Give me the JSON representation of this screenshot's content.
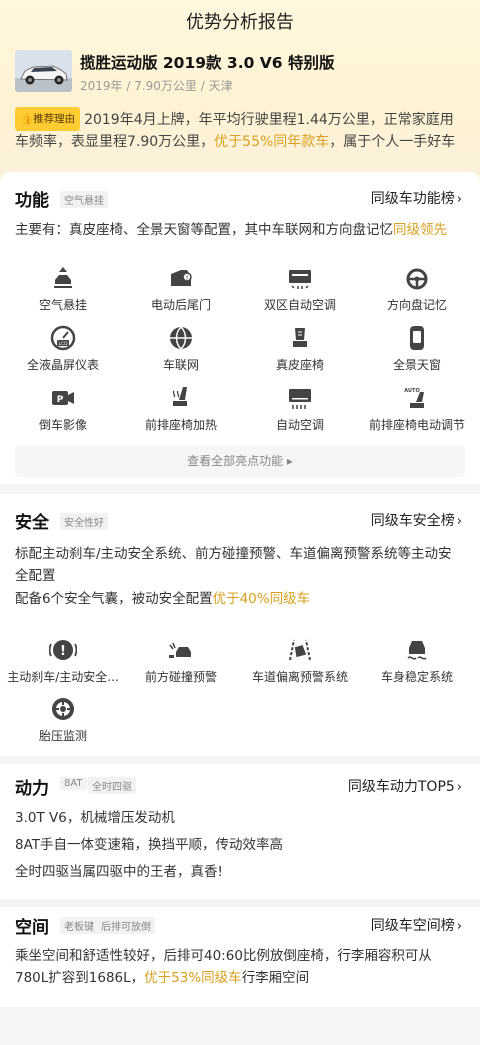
{
  "header": {
    "title": "优势分析报告"
  },
  "car": {
    "name": "揽胜运动版 2019款 3.0 V6 特别版",
    "meta": "2019年 / 7.90万公里 / 天津"
  },
  "reason": {
    "badge": "推荐理由",
    "text_before": "2019年4月上牌，年平均行驶里程1.44万公里，正常家庭用车频率，表显里程7.90万公里，",
    "highlight": "优于55%同年款车",
    "text_after": "，属于个人一手好车"
  },
  "function": {
    "title": "功能",
    "tag": "空气悬挂",
    "link": "同级车功能榜",
    "summary_before": "主要有：真皮座椅、全景天窗等配置，其中车联网和方向盘记忆",
    "summary_hl": "同级领先",
    "features": [
      {
        "label": "空气悬挂",
        "icon": "air-suspension-icon"
      },
      {
        "label": "电动后尾门",
        "icon": "power-tailgate-icon"
      },
      {
        "label": "双区自动空调",
        "icon": "dual-zone-ac-icon"
      },
      {
        "label": "方向盘记忆",
        "icon": "steering-memory-icon"
      },
      {
        "label": "全液晶屏仪表",
        "icon": "lcd-cluster-icon"
      },
      {
        "label": "车联网",
        "icon": "connected-car-icon"
      },
      {
        "label": "真皮座椅",
        "icon": "leather-seat-icon"
      },
      {
        "label": "全景天窗",
        "icon": "panoramic-roof-icon"
      },
      {
        "label": "倒车影像",
        "icon": "reverse-camera-icon"
      },
      {
        "label": "前排座椅加热",
        "icon": "seat-heating-icon"
      },
      {
        "label": "自动空调",
        "icon": "auto-ac-icon"
      },
      {
        "label": "前排座椅电动调节",
        "icon": "power-seat-icon"
      }
    ],
    "more": "查看全部亮点功能"
  },
  "safety": {
    "title": "安全",
    "tag": "安全性好",
    "link": "同级车安全榜",
    "p1": "标配主动刹车/主动安全系统、前方碰撞预警、车道偏离预警系统等主动安全配置",
    "p2_before": "配备6个安全气囊，被动安全配置",
    "p2_hl": "优于40%同级车",
    "features": [
      {
        "label": "主动刹车/主动安全...",
        "icon": "active-brake-icon"
      },
      {
        "label": "前方碰撞预警",
        "icon": "collision-warning-icon"
      },
      {
        "label": "车道偏离预警系统",
        "icon": "lane-departure-icon"
      },
      {
        "label": "车身稳定系统",
        "icon": "stability-control-icon"
      },
      {
        "label": "胎压监测",
        "icon": "tire-pressure-icon"
      }
    ]
  },
  "power": {
    "title": "动力",
    "tags": [
      "8AT",
      "全时四驱"
    ],
    "link": "同级车动力TOP5",
    "lines": [
      "3.0T V6，机械增压发动机",
      "8AT手自一体变速箱，换挡平顺，传动效率高",
      "全时四驱当属四驱中的王者，真香!"
    ]
  },
  "space": {
    "title": "空间",
    "tags": [
      "老板键",
      "后排可放倒"
    ],
    "link": "同级车空间榜",
    "text_before": "乘坐空间和舒适性较好，后排可40:60比例放倒座椅，行李厢容积可从780L扩容到1686L，",
    "text_hl": "优于53%同级车",
    "text_after": "行李厢空间"
  },
  "colors": {
    "accent": "#d8a020",
    "badge": "#ffcc33"
  }
}
